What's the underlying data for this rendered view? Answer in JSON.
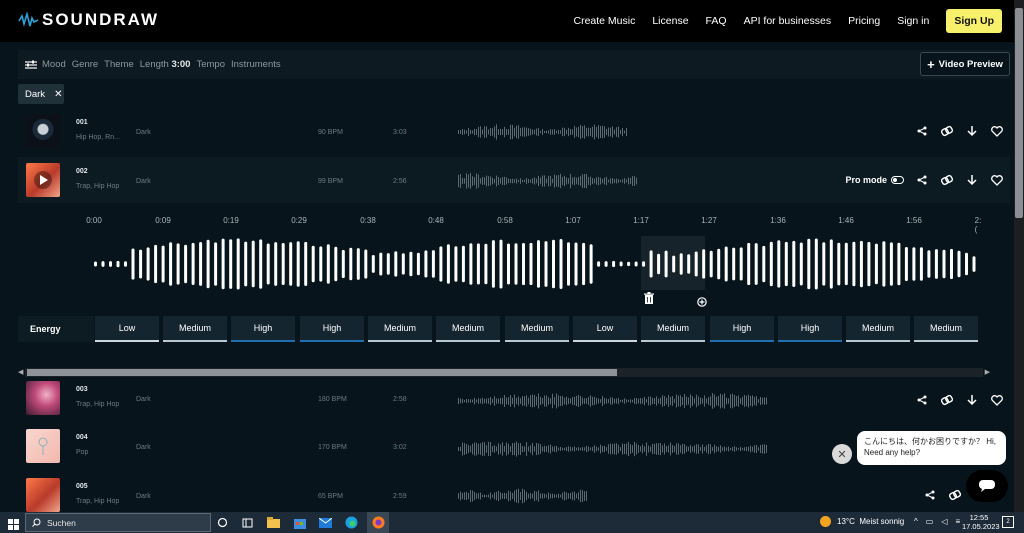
{
  "brand": {
    "name": "SOUNDRAW",
    "accent": "#f7f06a"
  },
  "nav": {
    "items": [
      "Create Music",
      "License",
      "FAQ",
      "API for businesses",
      "Pricing",
      "Sign in"
    ],
    "signup": "Sign Up"
  },
  "filters": {
    "items": [
      "Mood",
      "Genre",
      "Theme"
    ],
    "length_label": "Length",
    "length_value": "3:00",
    "items2": [
      "Tempo",
      "Instruments"
    ],
    "video_preview": "Video Preview",
    "active_chip": "Dark"
  },
  "tracks": [
    {
      "num": "001",
      "genre": "Hip Hop, Rn...",
      "mood": "Dark",
      "bpm": "90 BPM",
      "duration": "3:03"
    },
    {
      "num": "002",
      "genre": "Trap, Hip Hop",
      "mood": "Dark",
      "bpm": "99 BPM",
      "duration": "2:56",
      "pro_mode": "Pro mode"
    },
    {
      "num": "003",
      "genre": "Trap, Hip Hop",
      "mood": "Dark",
      "bpm": "180 BPM",
      "duration": "2:58"
    },
    {
      "num": "004",
      "genre": "Pop",
      "mood": "Dark",
      "bpm": "170 BPM",
      "duration": "3:02"
    },
    {
      "num": "005",
      "genre": "Trap, Hip Hop",
      "mood": "Dark",
      "bpm": "65 BPM",
      "duration": "2:59"
    }
  ],
  "editor": {
    "ticks": [
      "0:00",
      "0:09",
      "0:19",
      "0:29",
      "0:38",
      "0:48",
      "0:58",
      "1:07",
      "1:17",
      "1:27",
      "1:36",
      "1:46",
      "1:56",
      "2:("
    ],
    "energy_label": "Energy",
    "energy": [
      "Low",
      "Medium",
      "High",
      "High",
      "Medium",
      "Medium",
      "Medium",
      "Low",
      "Medium",
      "High",
      "High",
      "Medium",
      "Medium"
    ]
  },
  "chat": {
    "message": "こんにちは、何かお困りですか？ Hi, Need any help?"
  },
  "taskbar": {
    "search": "Suchen",
    "temp": "13°C",
    "weather": "Meist sonnig",
    "time": "12:55",
    "date": "17.05.2023",
    "notifications": "2"
  }
}
